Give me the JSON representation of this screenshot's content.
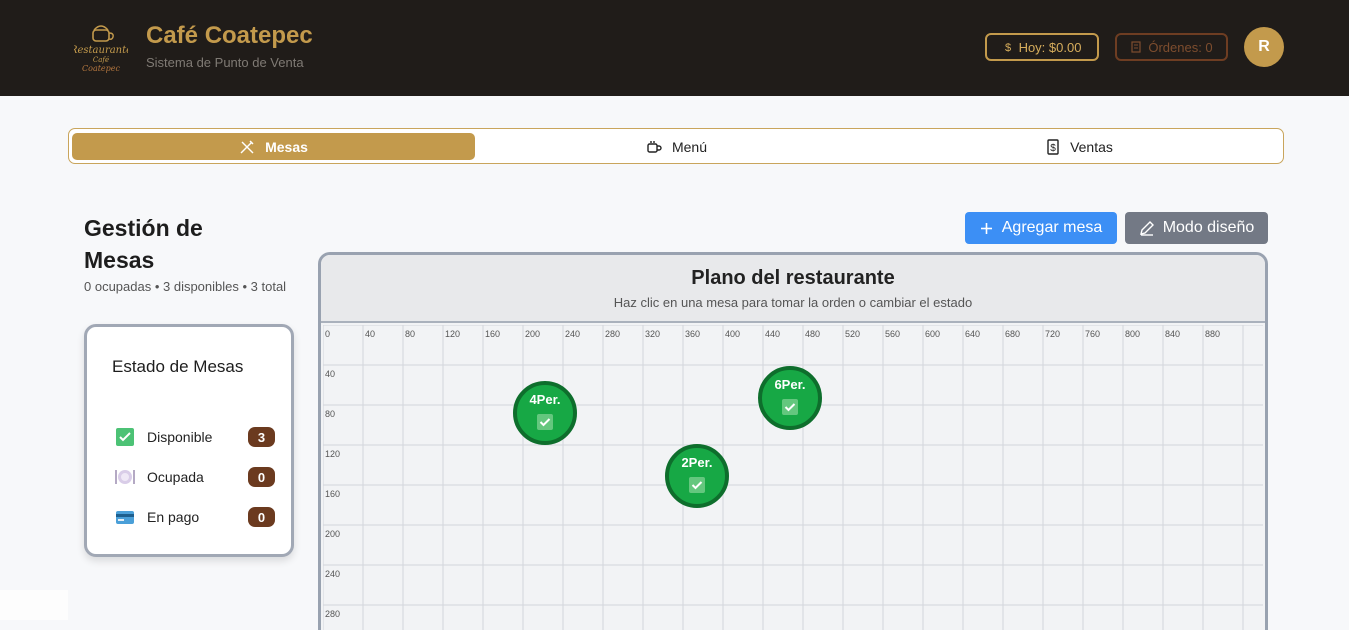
{
  "header": {
    "brand": "Café Coatepec",
    "subtitle": "Sistema de Punto de Venta",
    "today_label": "Hoy: $0.00",
    "orders_label": "Órdenes: 0",
    "avatar_initial": "R",
    "logo_text": "Restaurante Café Coatepec"
  },
  "tabs": [
    {
      "label": "Mesas",
      "icon": "utensils-crossed-icon",
      "active": true
    },
    {
      "label": "Menú",
      "icon": "coffee-cup-icon",
      "active": false
    },
    {
      "label": "Ventas",
      "icon": "receipt-dollar-icon",
      "active": false
    }
  ],
  "page": {
    "title": "Gestión de Mesas",
    "summary": "0 ocupadas • 3 disponibles • 3 total"
  },
  "status_card": {
    "title": "Estado de Mesas",
    "rows": [
      {
        "label": "Disponible",
        "count": "3",
        "icon": "check-box-icon"
      },
      {
        "label": "Ocupada",
        "count": "0",
        "icon": "plate-icon"
      },
      {
        "label": "En pago",
        "count": "0",
        "icon": "credit-card-icon"
      }
    ]
  },
  "actions": {
    "add_table": "Agregar mesa",
    "design_mode": "Modo diseño"
  },
  "plan": {
    "title": "Plano del restaurante",
    "subtitle": "Haz clic en una mesa para tomar la orden o cambiar el estado",
    "x_ticks": [
      "0",
      "40",
      "80",
      "120",
      "160",
      "200",
      "240",
      "280",
      "320",
      "360",
      "400",
      "440",
      "480",
      "520",
      "560",
      "600",
      "640",
      "680",
      "720",
      "760",
      "800",
      "840",
      "880"
    ],
    "y_ticks": [
      "40",
      "80",
      "120",
      "160",
      "200",
      "240",
      "280"
    ],
    "tables": [
      {
        "label": "4Per.",
        "status": "Disponible",
        "x": 200,
        "y": 80
      },
      {
        "label": "6Per.",
        "status": "Disponible",
        "x": 445,
        "y": 65
      },
      {
        "label": "2Per.",
        "status": "Disponible",
        "x": 352,
        "y": 143
      }
    ]
  },
  "colors": {
    "header_bg": "#201c19",
    "accent": "#c39a4c",
    "table_available": "#17a845",
    "badge": "#6b3a1f",
    "primary_button": "#3c8ff5",
    "secondary_button": "#737985"
  }
}
